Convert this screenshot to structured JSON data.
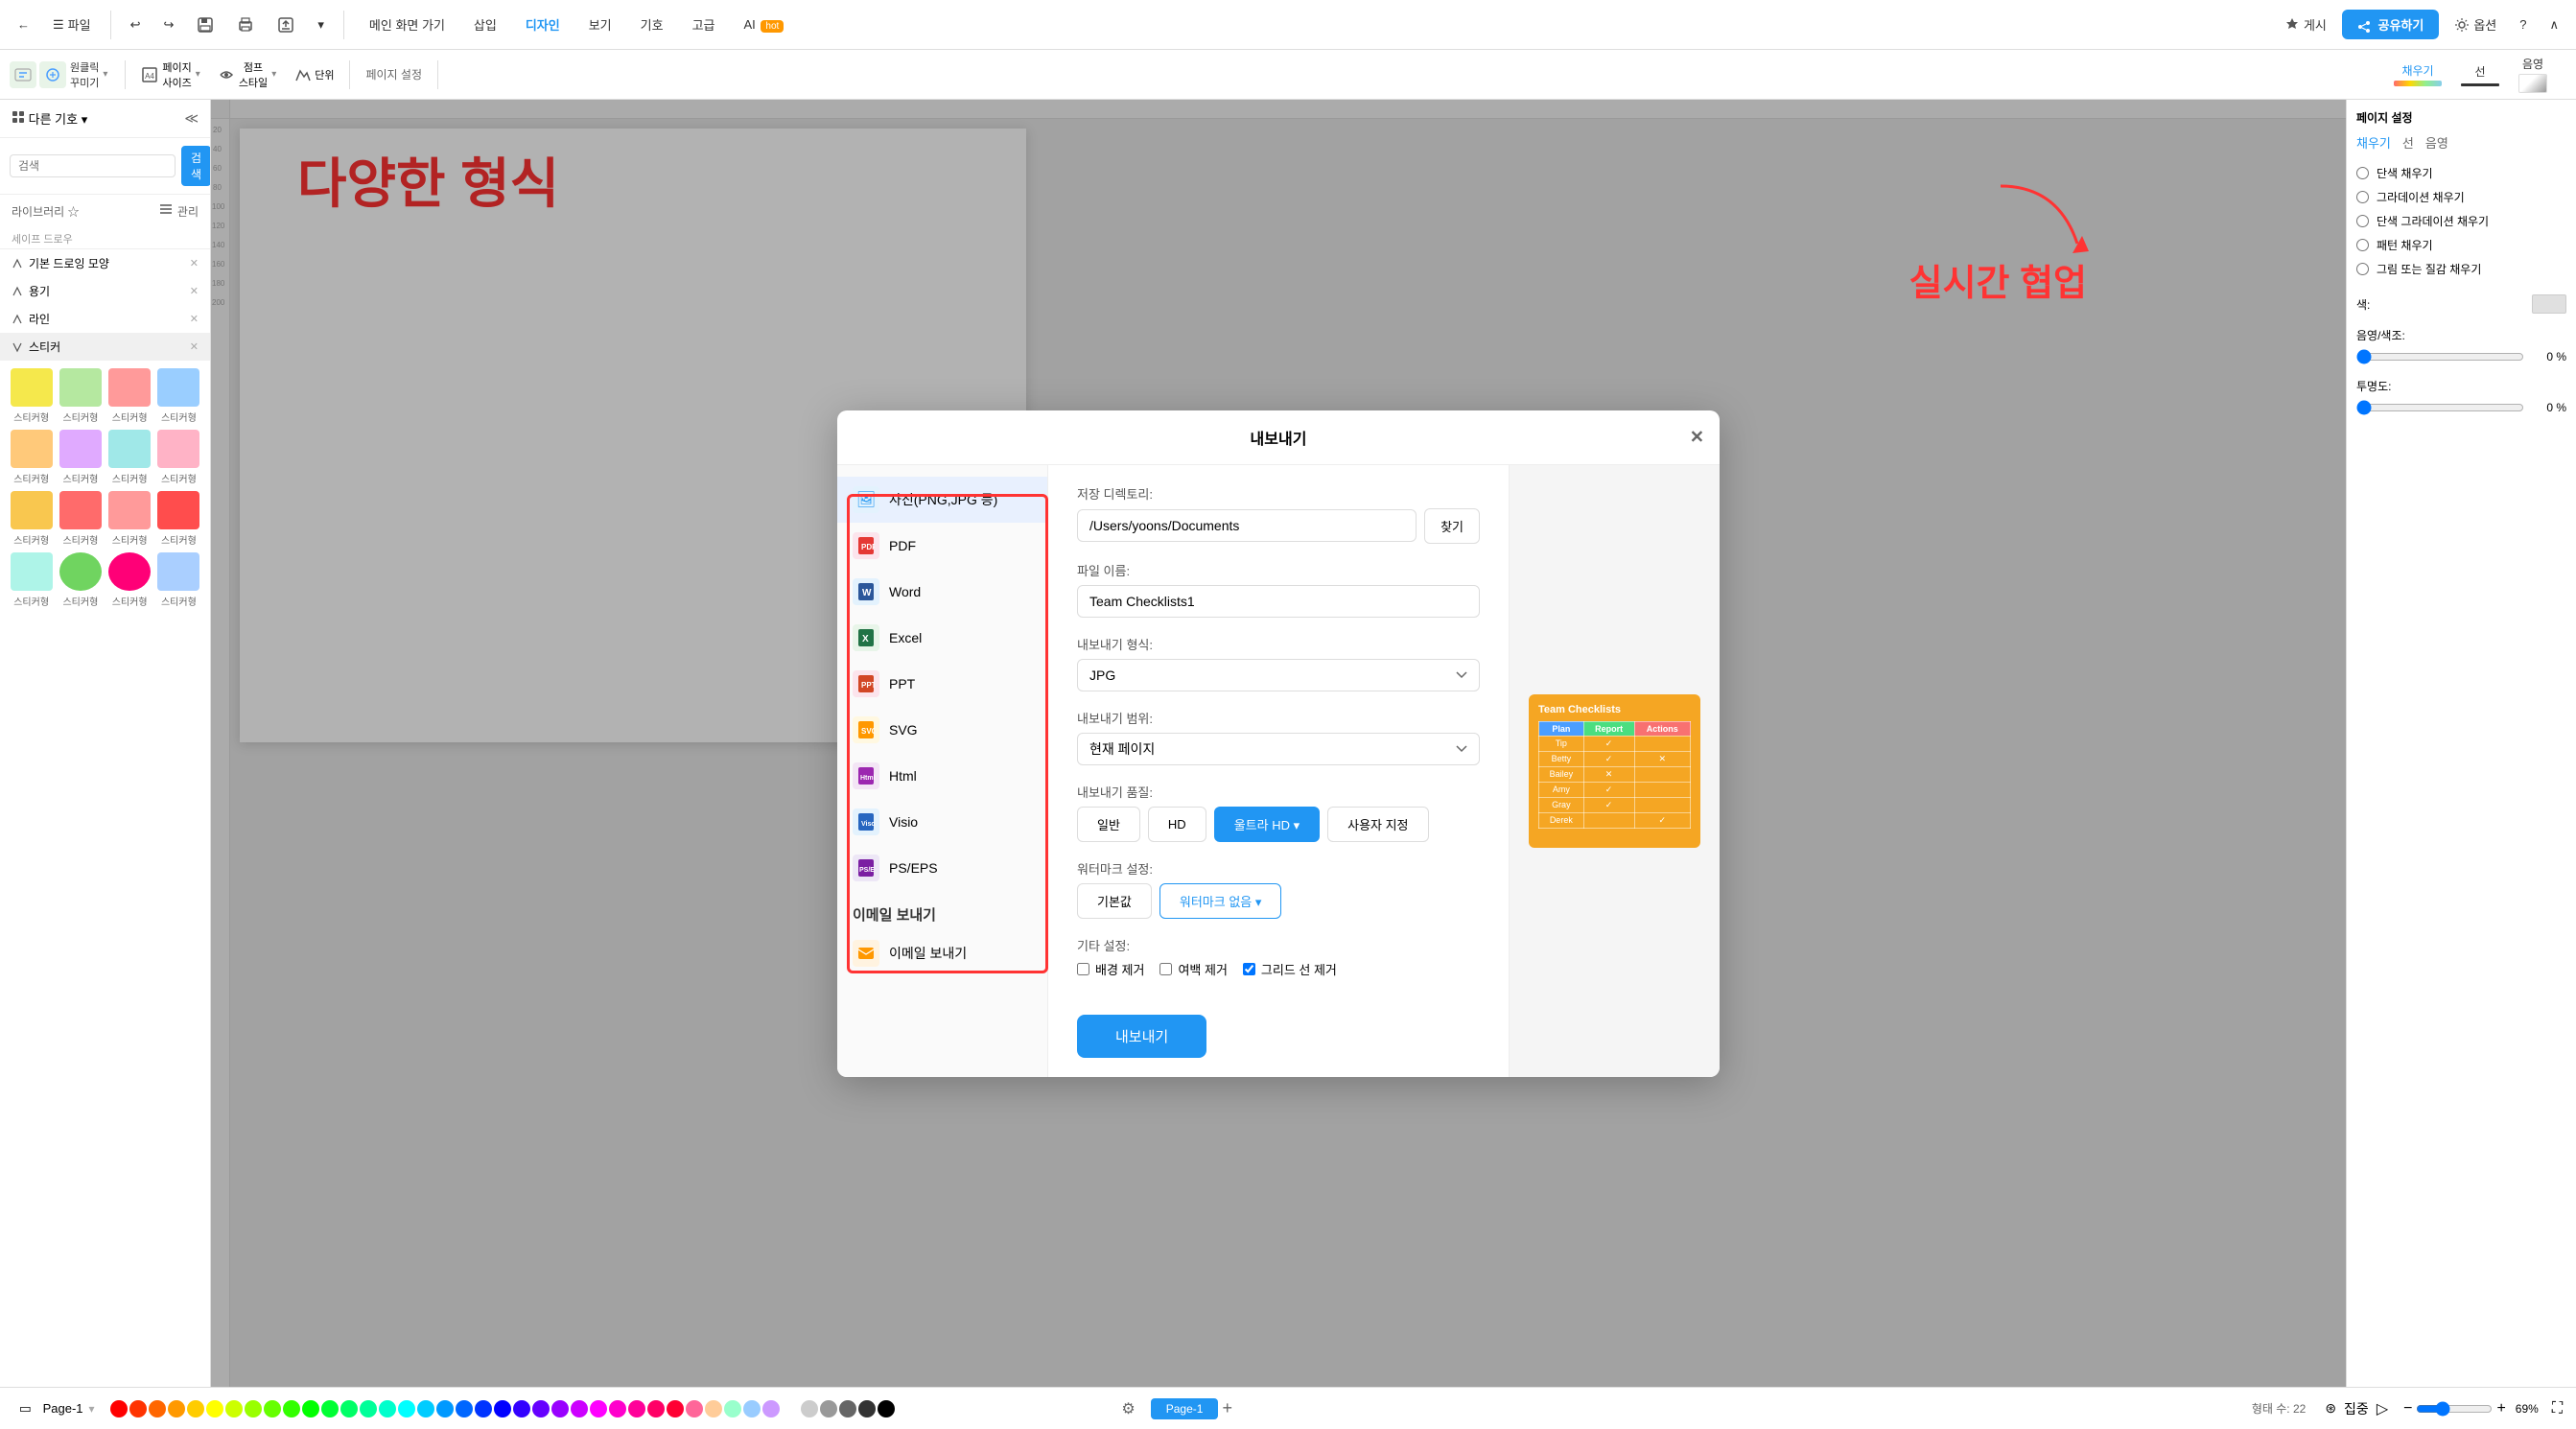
{
  "app": {
    "title": "내보내기"
  },
  "toolbar": {
    "back": "←",
    "file": "파일",
    "undo": "↩",
    "redo": "↪",
    "save": "💾",
    "print": "🖨",
    "export": "↗",
    "more": "▾",
    "main_home": "메인 화면 가기",
    "insert": "삽입",
    "design": "디자인",
    "view": "보기",
    "symbol": "기호",
    "advanced": "고급",
    "ai": "AI",
    "ai_badge": "hot",
    "publish": "게시",
    "share": "공유하기",
    "options": "옵션",
    "help": "?"
  },
  "toolbar2": {
    "one_click": "원클릭\n꾸미기",
    "page_settings": "페이지\n사이즈",
    "jump_style": "점프\n스타일",
    "unit": "단위",
    "page_setup": "페이지 설정",
    "fill": "채우기",
    "line": "선",
    "shadow": "음영"
  },
  "sidebar": {
    "other_symbols": "다른 기호",
    "search_placeholder": "검색",
    "search_btn": "검색",
    "library": "라이브러리 ☆",
    "manage": "관리",
    "shapes_label": "세이프 드로우",
    "basic_drawing": "기본 드로잉 모양",
    "container": "용기",
    "line": "라인",
    "sticker": "스티커",
    "sticker_items": [
      {
        "label": "스티커형",
        "color": "s1"
      },
      {
        "label": "스티커형",
        "color": "s2"
      },
      {
        "label": "스티커형",
        "color": "s3"
      },
      {
        "label": "스티커형",
        "color": "s4"
      },
      {
        "label": "스티커형",
        "color": "s5"
      },
      {
        "label": "스티커형",
        "color": "s6"
      },
      {
        "label": "스티커형",
        "color": "s7"
      },
      {
        "label": "스티커형",
        "color": "s8"
      },
      {
        "label": "스티커형",
        "color": "s1"
      },
      {
        "label": "스티커형",
        "color": "s3"
      },
      {
        "label": "스티커형",
        "color": "s5"
      },
      {
        "label": "스티커형",
        "color": "s2"
      },
      {
        "label": "스티커형",
        "color": "s7"
      },
      {
        "label": "스티커형",
        "color": "s4"
      },
      {
        "label": "스티커형",
        "color": "s6"
      },
      {
        "label": "스티커형",
        "color": "s8"
      },
      {
        "label": "스티커형",
        "color": "s1"
      },
      {
        "label": "스티커형",
        "color": "s5"
      },
      {
        "label": "스티커형",
        "color": "s7"
      },
      {
        "label": "스티커형",
        "color": "s3"
      }
    ]
  },
  "canvas": {
    "title": "다양한 형식",
    "subtitle": "실시간 협업"
  },
  "dialog": {
    "title": "내보내기",
    "formats": [
      {
        "id": "photo",
        "label": "사진(PNG,JPG 등)",
        "icon": "🖼",
        "color": "#4a9eff",
        "active": true
      },
      {
        "id": "pdf",
        "label": "PDF",
        "icon": "📄",
        "color": "#ff4444"
      },
      {
        "id": "word",
        "label": "Word",
        "icon": "W",
        "color": "#2b579a"
      },
      {
        "id": "excel",
        "label": "Excel",
        "icon": "X",
        "color": "#217346"
      },
      {
        "id": "ppt",
        "label": "PPT",
        "icon": "P",
        "color": "#d24726"
      },
      {
        "id": "svg",
        "label": "SVG",
        "icon": "S",
        "color": "#ff9800"
      },
      {
        "id": "html",
        "label": "Html",
        "icon": "H",
        "color": "#9c27b0"
      },
      {
        "id": "visio",
        "label": "Visio",
        "icon": "V",
        "color": "#2196f3"
      },
      {
        "id": "pseps",
        "label": "PS/EPS",
        "icon": "P",
        "color": "#9c27b0"
      }
    ],
    "fields": {
      "save_dir_label": "저장 디렉토리:",
      "save_dir_value": "/Users/yoons/Documents",
      "browse_btn": "찾기",
      "filename_label": "파일 이름:",
      "filename_value": "Team Checklists1",
      "format_label": "내보내기 형식:",
      "format_value": "JPG",
      "range_label": "내보내기 범위:",
      "range_value": "현재 페이지",
      "quality_label": "내보내기 품질:",
      "quality_options": [
        "일반",
        "HD",
        "울트라 HD",
        "사용자 지정"
      ],
      "quality_active": "울트라 HD",
      "watermark_label": "워터마크 설정:",
      "watermark_options": [
        "기본값",
        "워터마크 없음"
      ],
      "watermark_active": "워터마크 없음",
      "other_label": "기타 설정:",
      "bg_remove": "배경 제거",
      "margin_remove": "여백 제거",
      "grid_remove": "그리드 선 제거",
      "grid_checked": true,
      "export_btn": "내보내기"
    },
    "email_section": "이메일 보내기",
    "email_send": "이메일 보내기"
  },
  "right_panel": {
    "fill_options": [
      "단색 채우기",
      "그라데이션 채우기",
      "단색 그라데이션 채우기",
      "패턴 채우기",
      "그림 또는 질감 채우기"
    ],
    "color_label": "색:",
    "shade_label": "음영/색조:",
    "shade_value": "0 %",
    "opacity_label": "투명도:",
    "opacity_value": "0 %"
  },
  "bottom_bar": {
    "page_label": "Page-1",
    "page_tab": "Page-1",
    "add_page": "+",
    "shape_count": "형태 수: 22",
    "zoom_level": "69%",
    "focus": "집중"
  },
  "colors": [
    "#ff0000",
    "#ff3300",
    "#ff6600",
    "#ff9900",
    "#ffcc00",
    "#ffff00",
    "#ccff00",
    "#99ff00",
    "#66ff00",
    "#33ff00",
    "#00ff00",
    "#00ff33",
    "#00ff66",
    "#00ff99",
    "#00ffcc",
    "#00ffff",
    "#00ccff",
    "#0099ff",
    "#0066ff",
    "#0033ff",
    "#0000ff",
    "#3300ff",
    "#6600ff",
    "#9900ff",
    "#cc00ff",
    "#ff00ff",
    "#ff00cc",
    "#ff0099",
    "#ff0066",
    "#ff0033",
    "#ff6699",
    "#ffcc99",
    "#99ffcc",
    "#99ccff",
    "#cc99ff",
    "#ffffff",
    "#cccccc",
    "#999999",
    "#666666",
    "#333333",
    "#000000"
  ]
}
